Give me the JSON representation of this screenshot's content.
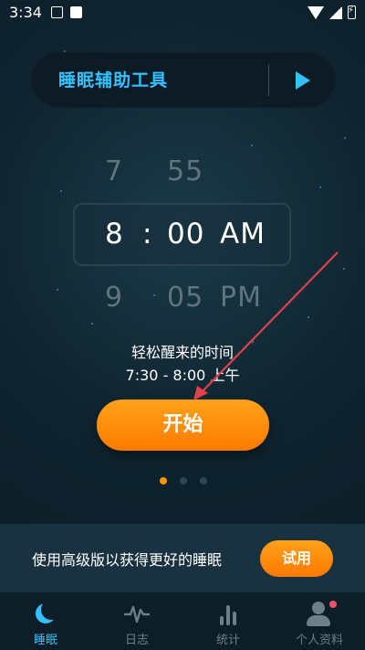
{
  "status_bar": {
    "time": "3:34"
  },
  "header": {
    "title": "睡眠辅助工具"
  },
  "picker": {
    "prev": {
      "hour": "7",
      "minute": "55",
      "ampm": ""
    },
    "selected": {
      "hour": "8",
      "separator": ":",
      "minute": "00",
      "ampm": "AM"
    },
    "next": {
      "hour": "9",
      "minute": "05",
      "ampm": "PM"
    }
  },
  "wake": {
    "label": "轻松醒来的时间",
    "range": "7:30 - 8:00 上午"
  },
  "start_button": "开始",
  "pagination": {
    "count": 3,
    "active_index": 0
  },
  "promo": {
    "text": "使用高级版以获得更好的睡眠",
    "button": "试用"
  },
  "nav": {
    "items": [
      {
        "label": "睡眠",
        "icon": "moon-icon",
        "active": true
      },
      {
        "label": "日志",
        "icon": "waveform-icon",
        "active": false
      },
      {
        "label": "统计",
        "icon": "bar-chart-icon",
        "active": false
      },
      {
        "label": "个人资料",
        "icon": "profile-icon",
        "active": false
      }
    ]
  },
  "colors": {
    "accent_blue": "#36c0ff",
    "accent_orange": "#ff8a00",
    "annotation_arrow": "#e0414c"
  }
}
